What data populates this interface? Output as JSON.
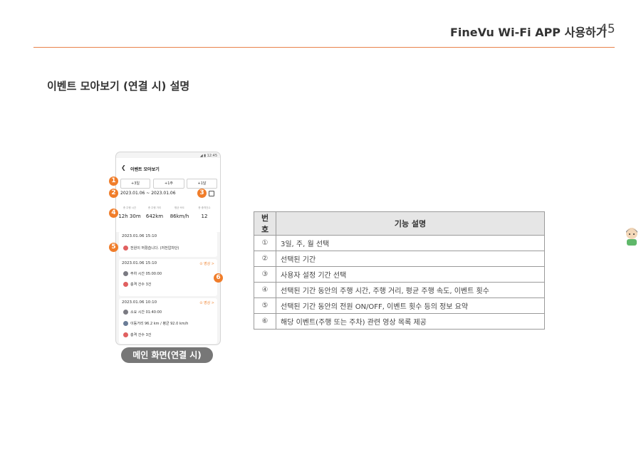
{
  "header": {
    "title": "FineVu Wi-Fi APP 사용하기",
    "page": "45"
  },
  "section_title": "이벤트 모아보기 (연결 시) 설명",
  "phone": {
    "status": "◢ ▮ 12:45",
    "back_icon": "chevron-left-icon",
    "title": "이벤트 모아보기",
    "period_buttons": [
      "+3일",
      "+1주",
      "+1달"
    ],
    "date_range": "2023.01.06 ~ 2023.01.06",
    "stats": [
      {
        "label": "총 주행 시간",
        "value": "12h 30m"
      },
      {
        "label": "총 주행 거리",
        "value": "642km"
      },
      {
        "label": "평균 속도",
        "value": "86km/h"
      },
      {
        "label": "총 충격건수",
        "value": "12"
      }
    ],
    "cards": [
      {
        "time": "2023.01.06 15:10",
        "rows": [
          "전원이 꺼졌습니다. (저전압차단)"
        ]
      },
      {
        "time": "2023.01.06 15:10",
        "link": "⊙ 영상 >",
        "rows": [
          "주차 시간 05:00:00",
          "충격 건수 3건"
        ]
      },
      {
        "time": "2023.01.06 10:10",
        "link": "⊙ 영상 >",
        "rows": [
          "소요 시간 01:40:00",
          "이동거리 96.2 km / 평균 92.0 km/h",
          "충격 건수 3건"
        ]
      }
    ],
    "markers": [
      "1",
      "2",
      "3",
      "4",
      "5",
      "6"
    ],
    "caption": "메인 화면(연결 시)"
  },
  "table": {
    "headers": [
      "번호",
      "기능 설명"
    ],
    "rows": [
      {
        "num": "①",
        "desc": "3일, 주, 월 선택"
      },
      {
        "num": "②",
        "desc": "선택된 기간"
      },
      {
        "num": "③",
        "desc": "사용자 설정 기간 선택"
      },
      {
        "num": "④",
        "desc": "선택된 기간 동안의 주행 시간, 주행 거리, 평균 주행 속도, 이벤트 횟수"
      },
      {
        "num": "⑤",
        "desc": "선택된 기간 동안의 전원 ON/OFF, 이벤트 횟수 등의 정보 요약"
      },
      {
        "num": "⑥",
        "desc": "해당 이벤트(주행 또는 주차) 관련 영상 목록 제공"
      }
    ]
  },
  "colors": {
    "accent": "#f07d2a",
    "rule": "#e8834a"
  }
}
